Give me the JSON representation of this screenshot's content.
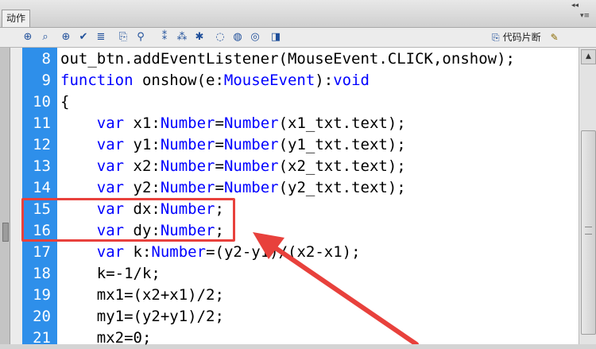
{
  "panel": {
    "tab_label": "动作",
    "collapse_glyph": "◂◂",
    "menu_glyph": "▾≡"
  },
  "toolbar": {
    "icons": [
      {
        "name": "add-action-icon",
        "glyph": "⊕"
      },
      {
        "name": "find-icon",
        "glyph": "⌕"
      },
      {
        "name": "target-path-icon",
        "glyph": "⊕"
      },
      {
        "name": "check-syntax-icon",
        "glyph": "✔"
      },
      {
        "name": "auto-format-icon",
        "glyph": "≣"
      },
      {
        "name": "code-hint-icon",
        "glyph": "⎘"
      },
      {
        "name": "debug-options-icon",
        "glyph": "⚲"
      },
      {
        "name": "collapse-between-braces-icon",
        "glyph": "⁑"
      },
      {
        "name": "collapse-selection-icon",
        "glyph": "⁂"
      },
      {
        "name": "expand-all-icon",
        "glyph": "✱"
      },
      {
        "name": "apply-block-comment-icon",
        "glyph": "◌"
      },
      {
        "name": "apply-line-comment-icon",
        "glyph": "◍"
      },
      {
        "name": "remove-comment-icon",
        "glyph": "◎"
      },
      {
        "name": "show-hide-toolbox-icon",
        "glyph": "◨"
      }
    ],
    "snippets_label": "代码片断",
    "wand_icon": "✎"
  },
  "code": {
    "lines": [
      {
        "n": "8",
        "indent": "",
        "kw": "",
        "text": "out_btn.addEventListener(MouseEvent.CLICK,onshow);"
      },
      {
        "n": "9",
        "indent": "",
        "kw": "function",
        "text": " onshow(e:MouseEvent):void"
      },
      {
        "n": "10",
        "indent": "",
        "kw": "",
        "text": "{"
      },
      {
        "n": "11",
        "indent": "    ",
        "kw": "var",
        "text": " x1:Number=Number(x1_txt.text);"
      },
      {
        "n": "12",
        "indent": "    ",
        "kw": "var",
        "text": " y1:Number=Number(y1_txt.text);"
      },
      {
        "n": "13",
        "indent": "    ",
        "kw": "var",
        "text": " x2:Number=Number(x2_txt.text);"
      },
      {
        "n": "14",
        "indent": "    ",
        "kw": "var",
        "text": " y2:Number=Number(y2_txt.text);"
      },
      {
        "n": "15",
        "indent": "    ",
        "kw": "var",
        "text": " dx:Number;"
      },
      {
        "n": "16",
        "indent": "    ",
        "kw": "var",
        "text": " dy:Number;"
      },
      {
        "n": "17",
        "indent": "    ",
        "kw": "var",
        "text": " k:Number=(y2-y1)/(x2-x1);"
      },
      {
        "n": "18",
        "indent": "    ",
        "kw": "",
        "text": "k=-1/k;"
      },
      {
        "n": "19",
        "indent": "    ",
        "kw": "",
        "text": "mx1=(x2+x1)/2;"
      },
      {
        "n": "20",
        "indent": "    ",
        "kw": "",
        "text": "my1=(y2+y1)/2;"
      },
      {
        "n": "21",
        "indent": "    ",
        "kw": "",
        "text": "mx2=0;"
      }
    ]
  },
  "annotation": {
    "color": "#e8413c"
  },
  "colors": {
    "gutter": "#2e8fea",
    "keyword": "#0000ff"
  }
}
